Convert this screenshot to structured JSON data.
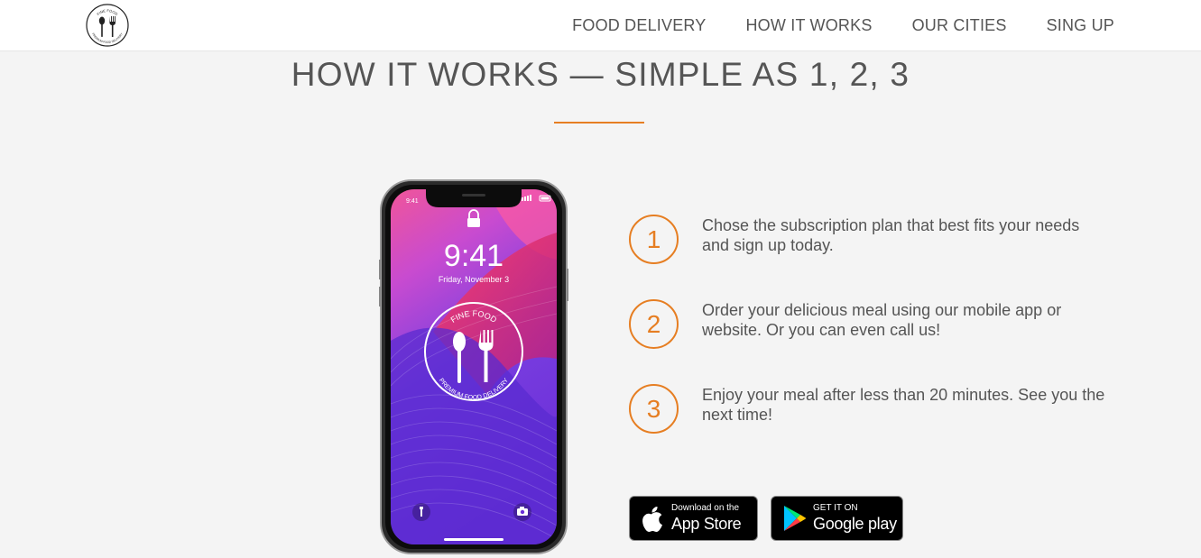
{
  "nav": {
    "logo": {
      "top_text": "FINE FOOD",
      "bottom_text": "PREMIUM FOOD DELIVERY"
    },
    "links": [
      {
        "label": "FOOD DELIVERY"
      },
      {
        "label": "HOW IT WORKS"
      },
      {
        "label": "OUR CITIES"
      },
      {
        "label": "SING UP"
      }
    ]
  },
  "section": {
    "title": "HOW IT WORKS — SIMPLE AS 1, 2, 3"
  },
  "phone": {
    "status_time": "9:41",
    "clock": "9:41",
    "date": "Friday, November 3",
    "badge_top_text": "FINE FOOD",
    "badge_bottom_text": "PREMIUM FOOD DELIVERY"
  },
  "steps": [
    {
      "number": "1",
      "text": "Chose the subscription plan that best fits your needs and sign up today."
    },
    {
      "number": "2",
      "text": "Order your delicious meal using our mobile app or website. Or you can even call us!"
    },
    {
      "number": "3",
      "text": "Enjoy your meal after less than 20 minutes. See you the next time!"
    }
  ],
  "store_buttons": {
    "app_store": {
      "small": "Download on the",
      "big": "App Store",
      "icon": "apple-icon"
    },
    "google_play": {
      "small": "GET IT ON",
      "big": "Google play",
      "icon": "google-play-icon"
    }
  },
  "colors": {
    "accent": "#e67e22",
    "background": "#f4f4f4",
    "navbar": "#ffffff"
  }
}
